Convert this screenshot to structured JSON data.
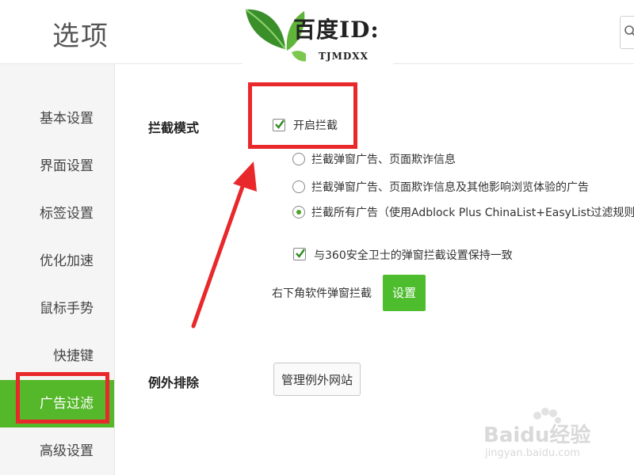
{
  "header": {
    "title": "选项"
  },
  "watermark_logo": {
    "text": "百度ID:",
    "sub": "TJMDXX"
  },
  "sidebar": {
    "items": [
      {
        "label": "基本设置"
      },
      {
        "label": "界面设置"
      },
      {
        "label": "标签设置"
      },
      {
        "label": "优化加速"
      },
      {
        "label": "鼠标手势"
      },
      {
        "label": "快捷键"
      },
      {
        "label": "广告过滤",
        "active": true
      },
      {
        "label": "高级设置"
      }
    ]
  },
  "adblock": {
    "section_label": "拦截模式",
    "enable_label": "开启拦截",
    "enable_checked": true,
    "options": [
      {
        "label": "拦截弹窗广告、页面欺诈信息",
        "selected": false
      },
      {
        "label": "拦截弹窗广告、页面欺诈信息及其他影响浏览体验的广告",
        "selected": false
      },
      {
        "label": "拦截所有广告（使用Adblock Plus ChinaList+EasyList过滤规则）",
        "selected": true
      }
    ],
    "sync_label": "与360安全卫士的弹窗拦截设置保持一致",
    "sync_checked": true,
    "popup_label": "右下角软件弹窗拦截",
    "settings_button": "设置"
  },
  "exceptions": {
    "section_label": "例外排除",
    "manage_button": "管理例外网站"
  },
  "jingyan_watermark": {
    "main": "Baidu经验",
    "sub": "jingyan.baidu.com"
  },
  "colors": {
    "accent": "#55b72a",
    "highlight": "#e8282b"
  }
}
